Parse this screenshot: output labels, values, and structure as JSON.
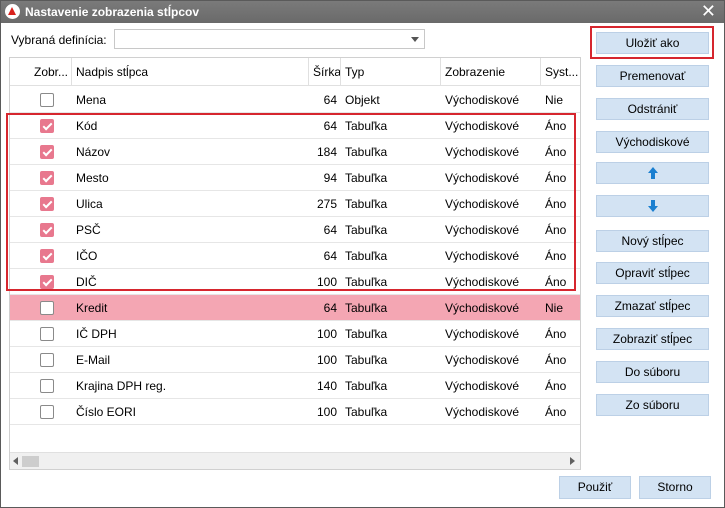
{
  "window": {
    "title": "Nastavenie zobrazenia stĺpcov",
    "close": "✕"
  },
  "definition": {
    "label": "Vybraná definícia:",
    "value": ""
  },
  "columns": {
    "show": "Zobr...",
    "caption": "Nadpis stĺpca",
    "width": "Šírka",
    "type": "Typ",
    "display": "Zobrazenie",
    "system": "Syst..."
  },
  "rows": [
    {
      "checked": false,
      "caption": "Mena",
      "width": "64",
      "type": "Objekt",
      "display": "Východiskové",
      "system": "Nie"
    },
    {
      "checked": true,
      "caption": "Kód",
      "width": "64",
      "type": "Tabuľka",
      "display": "Východiskové",
      "system": "Áno"
    },
    {
      "checked": true,
      "caption": "Názov",
      "width": "184",
      "type": "Tabuľka",
      "display": "Východiskové",
      "system": "Áno"
    },
    {
      "checked": true,
      "caption": "Mesto",
      "width": "94",
      "type": "Tabuľka",
      "display": "Východiskové",
      "system": "Áno"
    },
    {
      "checked": true,
      "caption": "Ulica",
      "width": "275",
      "type": "Tabuľka",
      "display": "Východiskové",
      "system": "Áno"
    },
    {
      "checked": true,
      "caption": "PSČ",
      "width": "64",
      "type": "Tabuľka",
      "display": "Východiskové",
      "system": "Áno"
    },
    {
      "checked": true,
      "caption": "IČO",
      "width": "64",
      "type": "Tabuľka",
      "display": "Východiskové",
      "system": "Áno"
    },
    {
      "checked": true,
      "caption": "DIČ",
      "width": "100",
      "type": "Tabuľka",
      "display": "Východiskové",
      "system": "Áno"
    },
    {
      "checked": false,
      "caption": "Kredit",
      "width": "64",
      "type": "Tabuľka",
      "display": "Východiskové",
      "system": "Nie",
      "highlight": true
    },
    {
      "checked": false,
      "caption": "IČ DPH",
      "width": "100",
      "type": "Tabuľka",
      "display": "Východiskové",
      "system": "Áno"
    },
    {
      "checked": false,
      "caption": "E-Mail",
      "width": "100",
      "type": "Tabuľka",
      "display": "Východiskové",
      "system": "Áno"
    },
    {
      "checked": false,
      "caption": "Krajina DPH reg.",
      "width": "140",
      "type": "Tabuľka",
      "display": "Východiskové",
      "system": "Áno"
    },
    {
      "checked": false,
      "caption": "Číslo EORI",
      "width": "100",
      "type": "Tabuľka",
      "display": "Východiskové",
      "system": "Áno"
    }
  ],
  "buttons": {
    "save_as": "Uložiť ako",
    "rename": "Premenovať",
    "remove": "Odstrániť",
    "default": "Východiskové",
    "move_up": "arrow-up-icon",
    "move_down": "arrow-down-icon",
    "new_column": "Nový stĺpec",
    "edit_column": "Opraviť stĺpec",
    "delete_column": "Zmazať stĺpec",
    "show_column": "Zobraziť stĺpec",
    "to_file": "Do súboru",
    "from_file": "Zo súboru",
    "apply": "Použiť",
    "cancel": "Storno"
  },
  "colors": {
    "highlight_row": "#f4a6b3",
    "checkbox_on": "#e8788e",
    "button_bg": "#d3e3f3",
    "callout": "#d6262e",
    "arrow": "#1a7fd0"
  }
}
